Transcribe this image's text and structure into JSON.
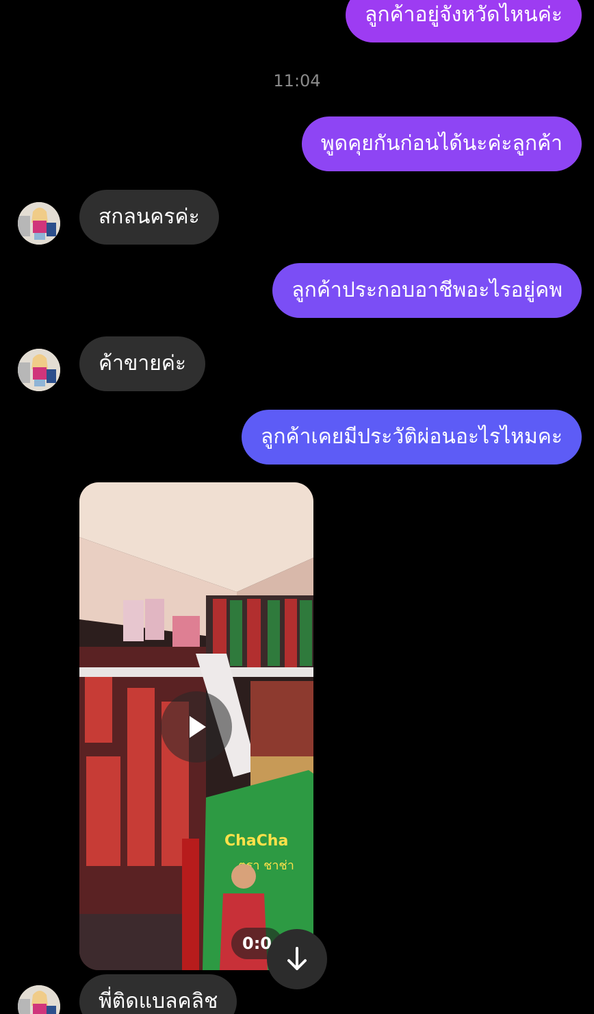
{
  "messages": {
    "out_1": "ลูกค้าอยู่จังหวัดไหนค่ะ",
    "timestamp": "11:04",
    "out_2": "พูดคุยกันก่อนได้นะค่ะลูกค้า",
    "in_1": "สกลนครค่ะ",
    "out_3": "ลูกค้าประกอบอาชีพอะไรอยู่คพ",
    "in_2": "ค้าขายค่ะ",
    "out_4": "ลูกค้าเคยมีประวัติผ่อนอะไรไหมคะ",
    "in_3": "พี่ติดแบลคลิช"
  },
  "video": {
    "duration": "0:0",
    "box_text_1": "ChaCha",
    "box_text_2": "ตรา ชาช่า"
  },
  "colors": {
    "outgoing_top": "#9d3cf2",
    "outgoing_bottom": "#5d5cf6",
    "incoming": "#2f2f2f",
    "background": "#000000"
  },
  "icons": {
    "play": "play-icon",
    "scroll_down": "arrow-down-icon"
  }
}
